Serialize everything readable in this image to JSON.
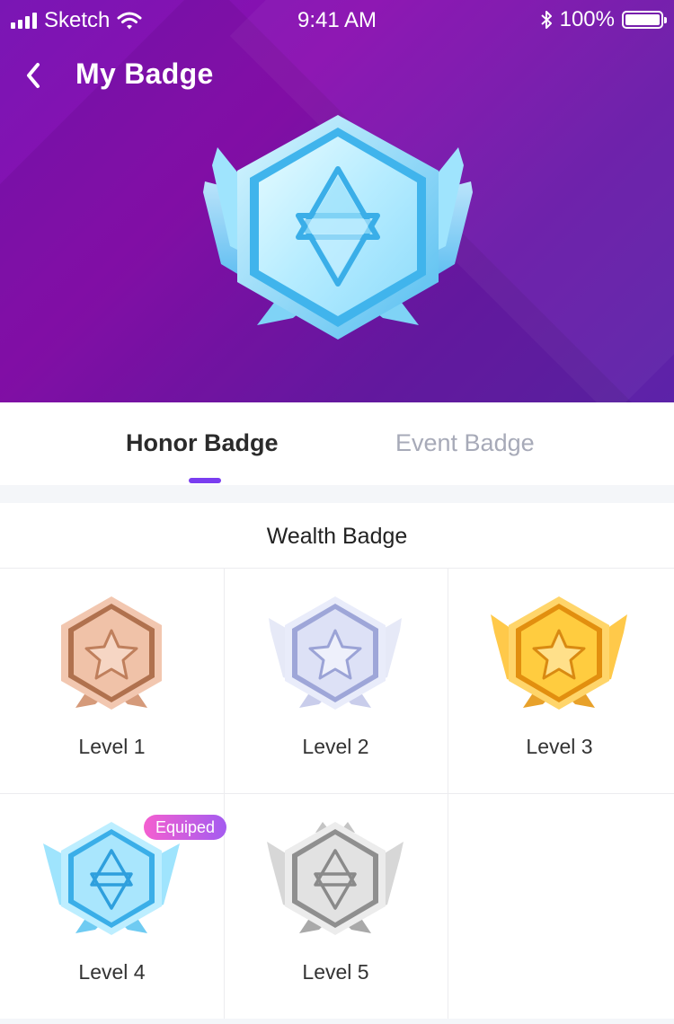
{
  "status_bar": {
    "carrier": "Sketch",
    "time": "9:41 AM",
    "battery": "100%",
    "battery_level": 1.0,
    "icons": [
      "signal-icon",
      "wifi-icon",
      "bluetooth-icon",
      "battery-icon"
    ]
  },
  "nav": {
    "title": "My Badge",
    "back_icon": "chevron-left-icon"
  },
  "hero": {
    "badge_level": "Level 4"
  },
  "tabs": [
    {
      "label": "Honor Badge",
      "active": true
    },
    {
      "label": "Event Badge",
      "active": false
    }
  ],
  "section": {
    "title": "Wealth Badge"
  },
  "badges": [
    {
      "label": "Level 1",
      "tier": "bronze",
      "equipped": false
    },
    {
      "label": "Level 2",
      "tier": "silver-blue",
      "equipped": false
    },
    {
      "label": "Level 3",
      "tier": "gold",
      "equipped": false
    },
    {
      "label": "Level 4",
      "tier": "diamond",
      "equipped": true,
      "tag": "Equiped"
    },
    {
      "label": "Level 5",
      "tier": "platinum",
      "equipped": false
    }
  ],
  "colors": {
    "header_gradient_start": "#7a16b4",
    "header_gradient_end": "#5c23a8",
    "tab_indicator": "#7a3df0",
    "equipped_tag_start": "#f45fd0",
    "equipped_tag_end": "#a45cf0",
    "inactive_tab": "#a7aab8"
  }
}
